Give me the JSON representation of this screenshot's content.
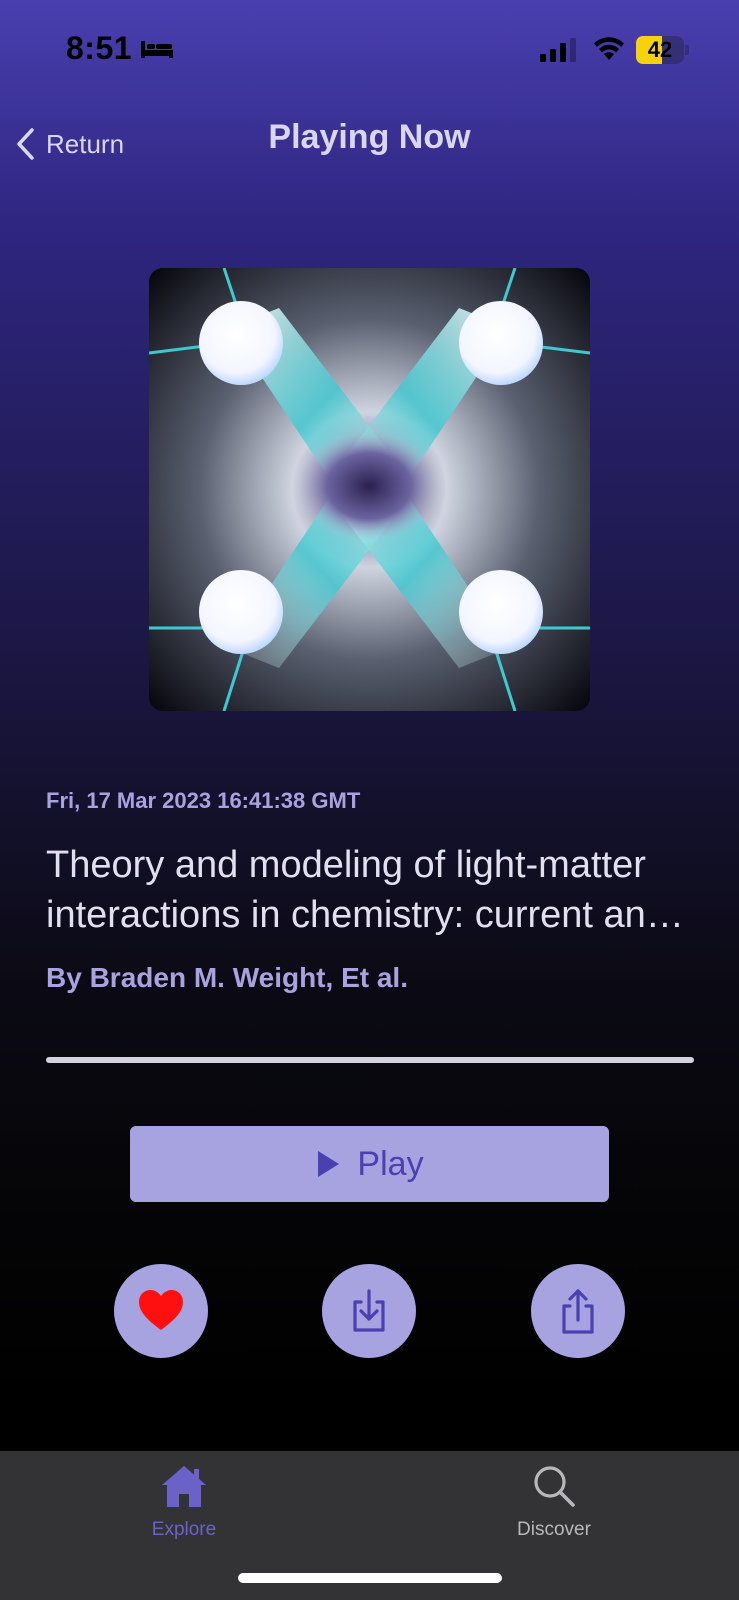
{
  "status_bar": {
    "time": "8:51",
    "battery_level": "42",
    "icons": [
      "bed-icon",
      "signal-icon",
      "wifi-icon",
      "battery-icon"
    ]
  },
  "nav": {
    "back_label": "Return",
    "back_icon": "chevron-left-icon",
    "title": "Playing Now"
  },
  "episode": {
    "date": "Fri, 17 Mar 2023 16:41:38 GMT",
    "title": "Theory and modeling of light-matter interactions in chemistry: current and future",
    "author": "By Braden M. Weight, Et al.",
    "progress": 0.0
  },
  "controls": {
    "play_label": "Play",
    "play_icon": "play-icon",
    "like_icon": "heart-icon",
    "download_icon": "download-icon",
    "share_icon": "share-icon"
  },
  "tabs": [
    {
      "label": "Explore",
      "icon": "house-icon",
      "active": true
    },
    {
      "label": "Discover",
      "icon": "magnifier-icon",
      "active": false
    }
  ],
  "colors": {
    "accent": "#a7a3e0",
    "accent_text": "#4a40b0",
    "heart": "#ff1010",
    "tab_active": "#6a62c8",
    "tab_inactive": "#b8b8bc"
  }
}
